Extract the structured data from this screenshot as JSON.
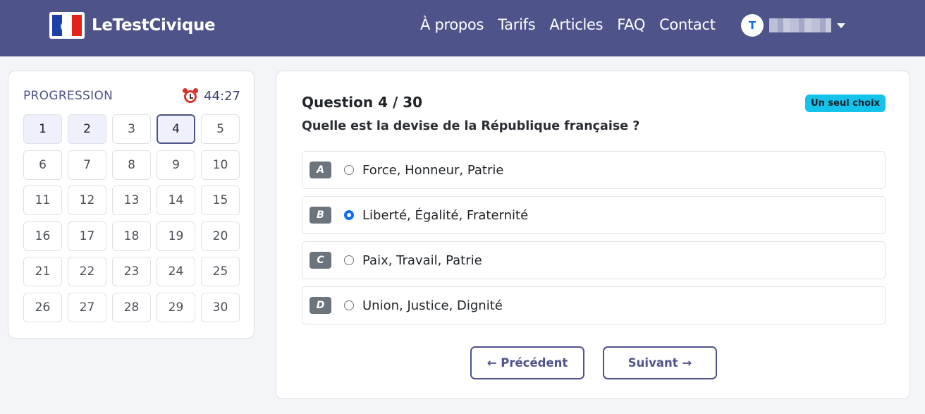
{
  "navbar": {
    "brand": "LeTestCivique",
    "links": [
      "À propos",
      "Tarifs",
      "Articles",
      "FAQ",
      "Contact"
    ],
    "user_initial": "T",
    "username": "████████"
  },
  "sidebar": {
    "title": "PROGRESSION",
    "timer": "44:27",
    "timer_icon": "alarm-clock-icon",
    "questions": [
      "1",
      "2",
      "3",
      "4",
      "5",
      "6",
      "7",
      "8",
      "9",
      "10",
      "11",
      "12",
      "13",
      "14",
      "15",
      "16",
      "17",
      "18",
      "19",
      "20",
      "21",
      "22",
      "23",
      "24",
      "25",
      "26",
      "27",
      "28",
      "29",
      "30"
    ],
    "answered": [
      1,
      2
    ],
    "current": 4
  },
  "question": {
    "title": "Question 4 / 30",
    "badge": "Un seul choix",
    "text": "Quelle est la devise de la République française ?",
    "options": [
      {
        "letter": "A",
        "label": "Force, Honneur, Patrie",
        "selected": false
      },
      {
        "letter": "B",
        "label": "Liberté, Égalité, Fraternité",
        "selected": true
      },
      {
        "letter": "C",
        "label": "Paix, Travail, Patrie",
        "selected": false
      },
      {
        "letter": "D",
        "label": "Union, Justice, Dignité",
        "selected": false
      }
    ],
    "prev_label": "← Précédent",
    "next_label": "Suivant →"
  },
  "colors": {
    "navbar": "#4e548a",
    "badge": "#14c3ea",
    "accent": "#0d6efd"
  }
}
